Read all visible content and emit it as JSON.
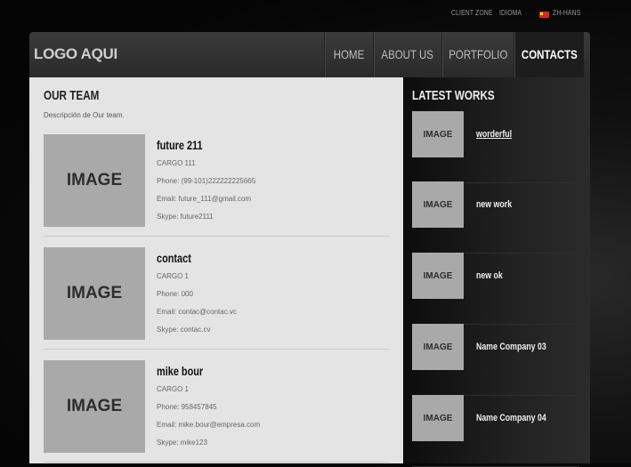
{
  "topbar": {
    "client_zone": "CLIENT ZONE",
    "idioma": "IDIOMA",
    "language": "ZH-HANS"
  },
  "header": {
    "logo": "LOGO AQUI",
    "nav": [
      {
        "label": "HOME",
        "active": false
      },
      {
        "label": "ABOUT US",
        "active": false
      },
      {
        "label": "PORTFOLIO",
        "active": false
      },
      {
        "label": "CONTACTS",
        "active": true
      }
    ]
  },
  "team": {
    "title": "OUR TEAM",
    "description": "Descripción de Our team.",
    "image_label": "IMAGE",
    "members": [
      {
        "name": "future 211",
        "cargo": "CARGO 111",
        "phone": "Phone: (99-101)222222225665",
        "email": "Email: future_111@gmail.com",
        "skype": "Skype: future2111"
      },
      {
        "name": "contact",
        "cargo": "CARGO 1",
        "phone": "Phone: 000",
        "email": "Email: contac@contac.vc",
        "skype": "Skype: contac.cv"
      },
      {
        "name": "mike bour",
        "cargo": "CARGO 1",
        "phone": "Phone: 958457845",
        "email": "Email: mike.bour@empresa.com",
        "skype": "Skype: mike123"
      }
    ]
  },
  "works": {
    "title": "LATEST WORKS",
    "image_label": "IMAGE",
    "items": [
      {
        "title": "worderful",
        "underlined": true
      },
      {
        "title": "new work",
        "underlined": false
      },
      {
        "title": "new ok",
        "underlined": false
      },
      {
        "title": "Name Company 03",
        "underlined": false
      },
      {
        "title": "Name Company 04",
        "underlined": false
      }
    ]
  },
  "colors": {
    "background": "#0a0a0a",
    "header": "#333333",
    "panel": "#e4e4e4",
    "image_placeholder": "#a9a9a9"
  }
}
